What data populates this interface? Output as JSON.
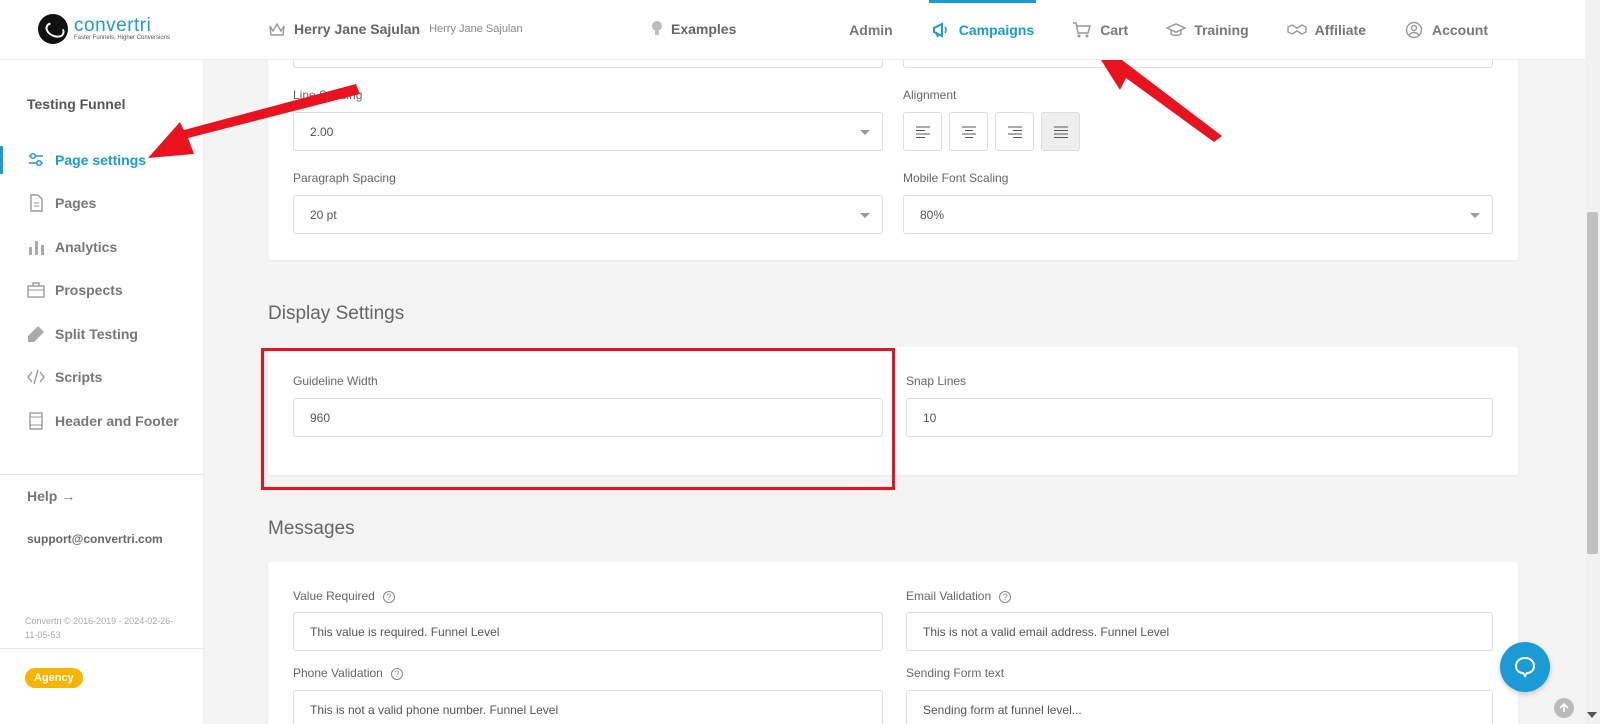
{
  "brand": {
    "name": "convertri",
    "tagline": "Faster Funnels, Higher Conversions"
  },
  "user": {
    "name": "Herry Jane Sajulan",
    "sub": "Herry Jane Sajulan"
  },
  "examples": "Examples",
  "nav": [
    {
      "label": "Admin",
      "icon": "none"
    },
    {
      "label": "Campaigns",
      "icon": "megaphone-icon"
    },
    {
      "label": "Cart",
      "icon": "cart-icon"
    },
    {
      "label": "Training",
      "icon": "graduation-cap-icon"
    },
    {
      "label": "Affiliate",
      "icon": "handshake-icon"
    },
    {
      "label": "Account",
      "icon": "user-circle-icon"
    }
  ],
  "sidebar": {
    "funnel_title": "Testing Funnel",
    "items": [
      {
        "label": "Page settings",
        "icon": "sliders-icon"
      },
      {
        "label": "Pages",
        "icon": "document-icon"
      },
      {
        "label": "Analytics",
        "icon": "bar-chart-icon"
      },
      {
        "label": "Prospects",
        "icon": "briefcase-icon"
      },
      {
        "label": "Split Testing",
        "icon": "flask-icon"
      },
      {
        "label": "Scripts",
        "icon": "code-icon"
      },
      {
        "label": "Header and Footer",
        "icon": "layout-icon"
      }
    ],
    "help": "Help",
    "support_email": "support@convertri.com",
    "copyright": "Convertri © 2016-2019 - 2024-02-26-11-05-53",
    "badge": "Agency"
  },
  "typography": {
    "line_spacing_label": "Line Spacing",
    "line_spacing_value": "2.00",
    "alignment_label": "Alignment",
    "paragraph_spacing_label": "Paragraph Spacing",
    "paragraph_spacing_value": "20 pt",
    "mobile_font_scaling_label": "Mobile Font Scaling",
    "mobile_font_scaling_value": "80%"
  },
  "display": {
    "title": "Display Settings",
    "guideline_width_label": "Guideline Width",
    "guideline_width_value": "960",
    "snap_lines_label": "Snap Lines",
    "snap_lines_value": "10"
  },
  "messages": {
    "title": "Messages",
    "value_required_label": "Value Required",
    "value_required_value": "This value is required. Funnel Level",
    "email_validation_label": "Email Validation",
    "email_validation_value": "This is not a valid email address. Funnel Level",
    "phone_validation_label": "Phone Validation",
    "phone_validation_value": "This is not a valid phone number. Funnel Level",
    "sending_form_label": "Sending Form text",
    "sending_form_value": "Sending form at funnel level..."
  },
  "colors": {
    "accent": "#1b9ad6",
    "annotation": "#e8131f",
    "badge": "#f7b500"
  }
}
